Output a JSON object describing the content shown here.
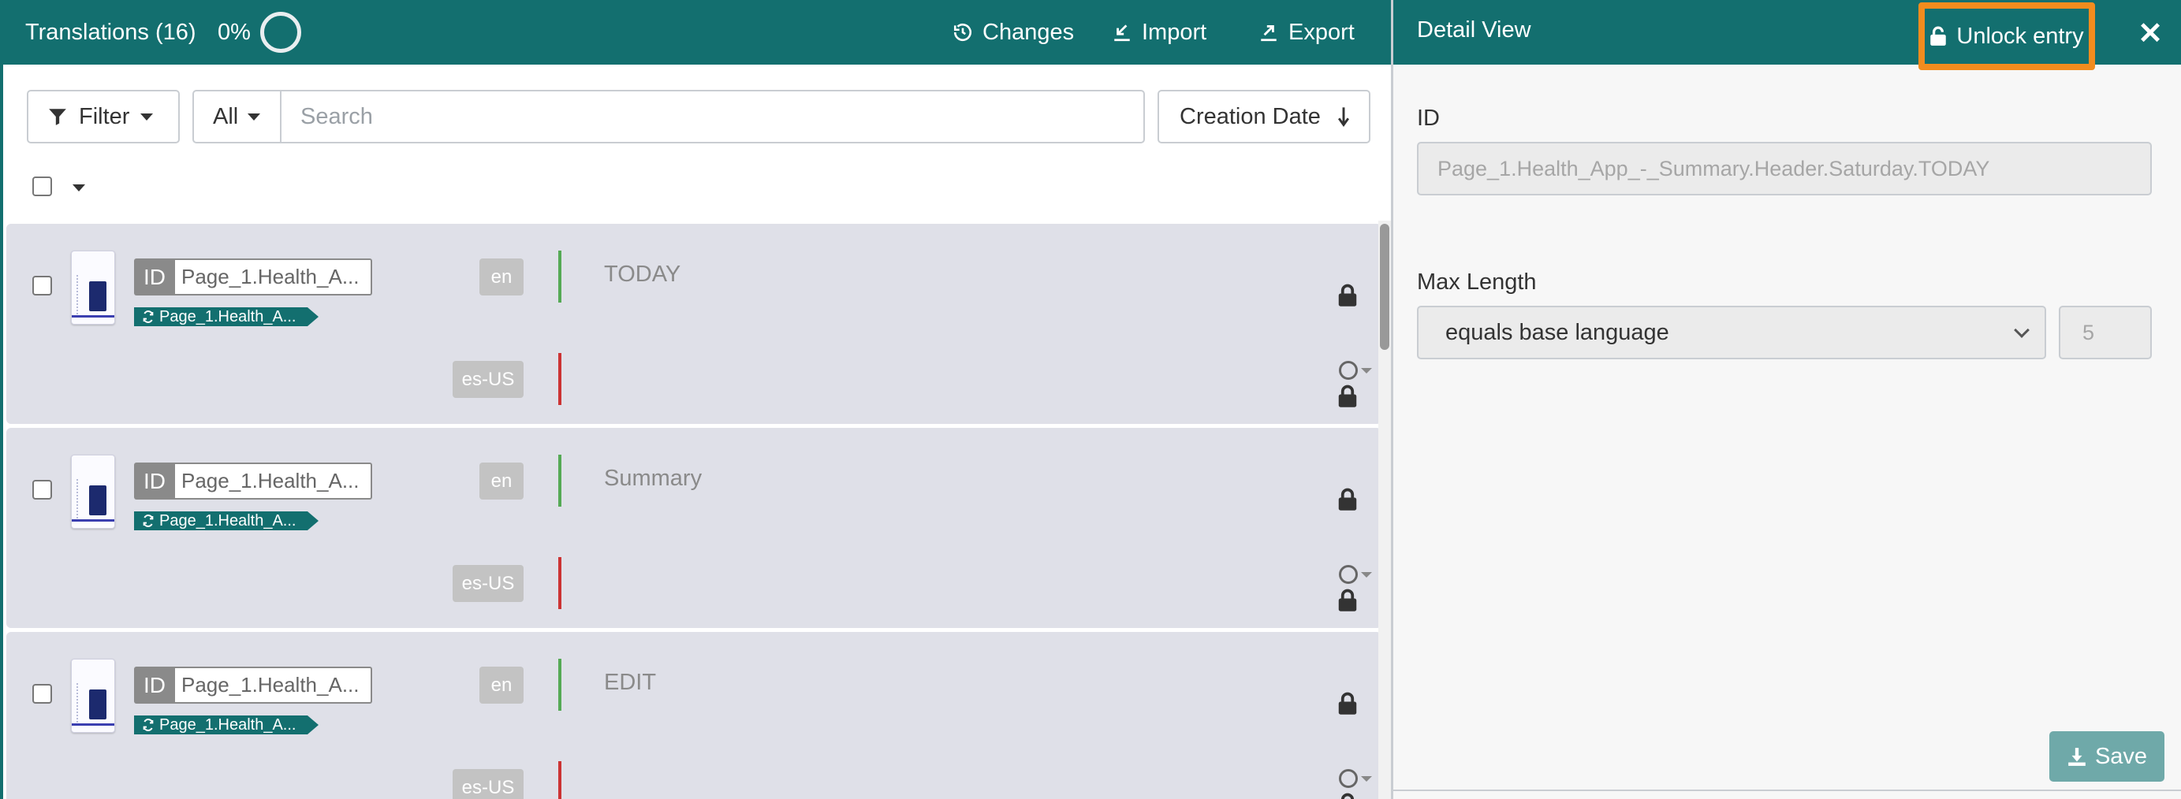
{
  "header": {
    "title": "Translations (16)",
    "progress": "0%",
    "actions": [
      {
        "label": "Changes",
        "icon": "history-icon"
      },
      {
        "label": "Import",
        "icon": "import-icon"
      },
      {
        "label": "Export",
        "icon": "export-icon"
      }
    ]
  },
  "toolbar": {
    "filter_label": "Filter",
    "scope_value": "All",
    "search_placeholder": "Search",
    "sort_label": "Creation Date"
  },
  "rows": [
    {
      "id_label": "ID",
      "id_value": "Page_1.Health_A...",
      "tag": "Page_1.Health_A...",
      "base_lang": "en",
      "target_lang": "es-US",
      "source_text": "TODAY"
    },
    {
      "id_label": "ID",
      "id_value": "Page_1.Health_A...",
      "tag": "Page_1.Health_A...",
      "base_lang": "en",
      "target_lang": "es-US",
      "source_text": "Summary"
    },
    {
      "id_label": "ID",
      "id_value": "Page_1.Health_A...",
      "tag": "Page_1.Health_A...",
      "base_lang": "en",
      "target_lang": "es-US",
      "source_text": "EDIT"
    }
  ],
  "detail": {
    "title": "Detail View",
    "unlock_label": "Unlock entry",
    "close_symbol": "✕",
    "id_label": "ID",
    "id_value": "Page_1.Health_App_-_Summary.Header.Saturday.TODAY",
    "max_length_label": "Max Length",
    "max_length_mode": "equals base language",
    "max_length_value": "5",
    "save_label": "Save"
  },
  "colors": {
    "header_bg": "#136f6f",
    "highlight": "#f28c1e",
    "row_bg": "#dfe0e8",
    "base_lang_line": "#55aa55",
    "target_lang_line": "#cc3333"
  }
}
